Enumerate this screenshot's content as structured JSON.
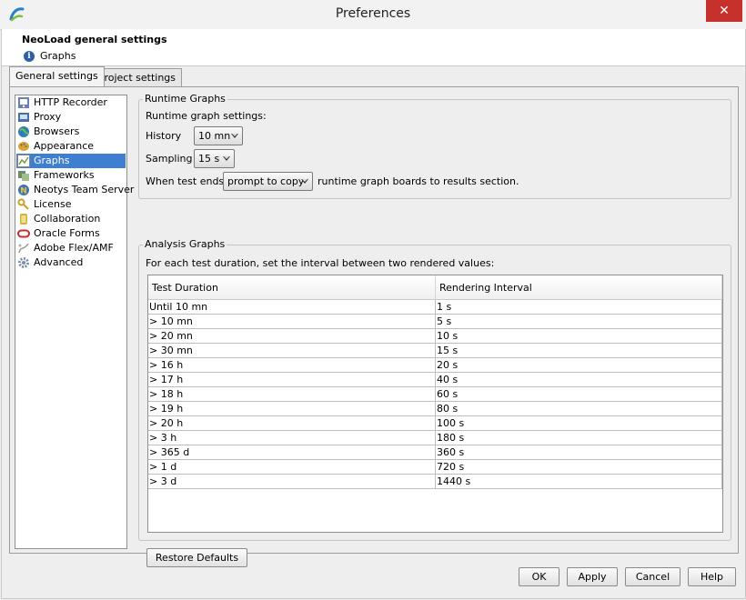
{
  "window": {
    "title": "Preferences",
    "close_glyph": "✕"
  },
  "header": {
    "title": "NeoLoad general settings",
    "subtitle": "Graphs",
    "info_glyph": "i"
  },
  "tabs": [
    {
      "label": "General settings",
      "active": true
    },
    {
      "label": "Project settings",
      "active": false
    }
  ],
  "sidebar": {
    "items": [
      {
        "label": "HTTP Recorder",
        "icon": "recorder-icon",
        "color": "#6b7fb3"
      },
      {
        "label": "Proxy",
        "icon": "proxy-icon",
        "color": "#4a6fa0"
      },
      {
        "label": "Browsers",
        "icon": "globe-icon",
        "color": "#2e7fb8"
      },
      {
        "label": "Appearance",
        "icon": "palette-icon",
        "color": "#d9a13a"
      },
      {
        "label": "Graphs",
        "icon": "graph-icon",
        "color": "#6f9d3a",
        "selected": true
      },
      {
        "label": "Frameworks",
        "icon": "frameworks-icon",
        "color": "#6f8a6a"
      },
      {
        "label": "Neotys Team Server",
        "icon": "team-server-icon",
        "color": "#3b76b5"
      },
      {
        "label": "License",
        "icon": "key-icon",
        "color": "#c9a227"
      },
      {
        "label": "Collaboration",
        "icon": "collaboration-icon",
        "color": "#d3b33a"
      },
      {
        "label": "Oracle Forms",
        "icon": "oracle-icon",
        "color": "#cc2a2a"
      },
      {
        "label": "Adobe Flex/AMF",
        "icon": "flex-icon",
        "color": "#9a9a9a"
      },
      {
        "label": "Advanced",
        "icon": "gear-icon",
        "color": "#7d8fa8"
      }
    ]
  },
  "runtime": {
    "group_title": "Runtime Graphs",
    "settings_label": "Runtime graph settings:",
    "history_label": "History",
    "history_value": "10 mn",
    "sampling_label": "Sampling",
    "sampling_value": "15 s",
    "when_label": "When test ends,",
    "when_value": "prompt to copy",
    "when_suffix": "runtime graph boards to results section."
  },
  "analysis": {
    "group_title": "Analysis Graphs",
    "description": "For each test duration, set the interval between two rendered values:",
    "columns": [
      "Test Duration",
      "Rendering Interval"
    ],
    "rows": [
      [
        "Until 10 mn",
        "1 s"
      ],
      [
        "> 10 mn",
        "5 s"
      ],
      [
        "> 20 mn",
        "10 s"
      ],
      [
        "> 30 mn",
        "15 s"
      ],
      [
        "> 16 h",
        "20 s"
      ],
      [
        "> 17 h",
        "40 s"
      ],
      [
        "> 18 h",
        "60 s"
      ],
      [
        "> 19 h",
        "80 s"
      ],
      [
        "> 20 h",
        "100 s"
      ],
      [
        "> 3 h",
        "180 s"
      ],
      [
        "> 365 d",
        "360 s"
      ],
      [
        "> 1 d",
        "720 s"
      ],
      [
        "> 3 d",
        "1440 s"
      ]
    ],
    "restore_label": "Restore Defaults"
  },
  "footer": {
    "ok": "OK",
    "apply": "Apply",
    "cancel": "Cancel",
    "help": "Help"
  }
}
